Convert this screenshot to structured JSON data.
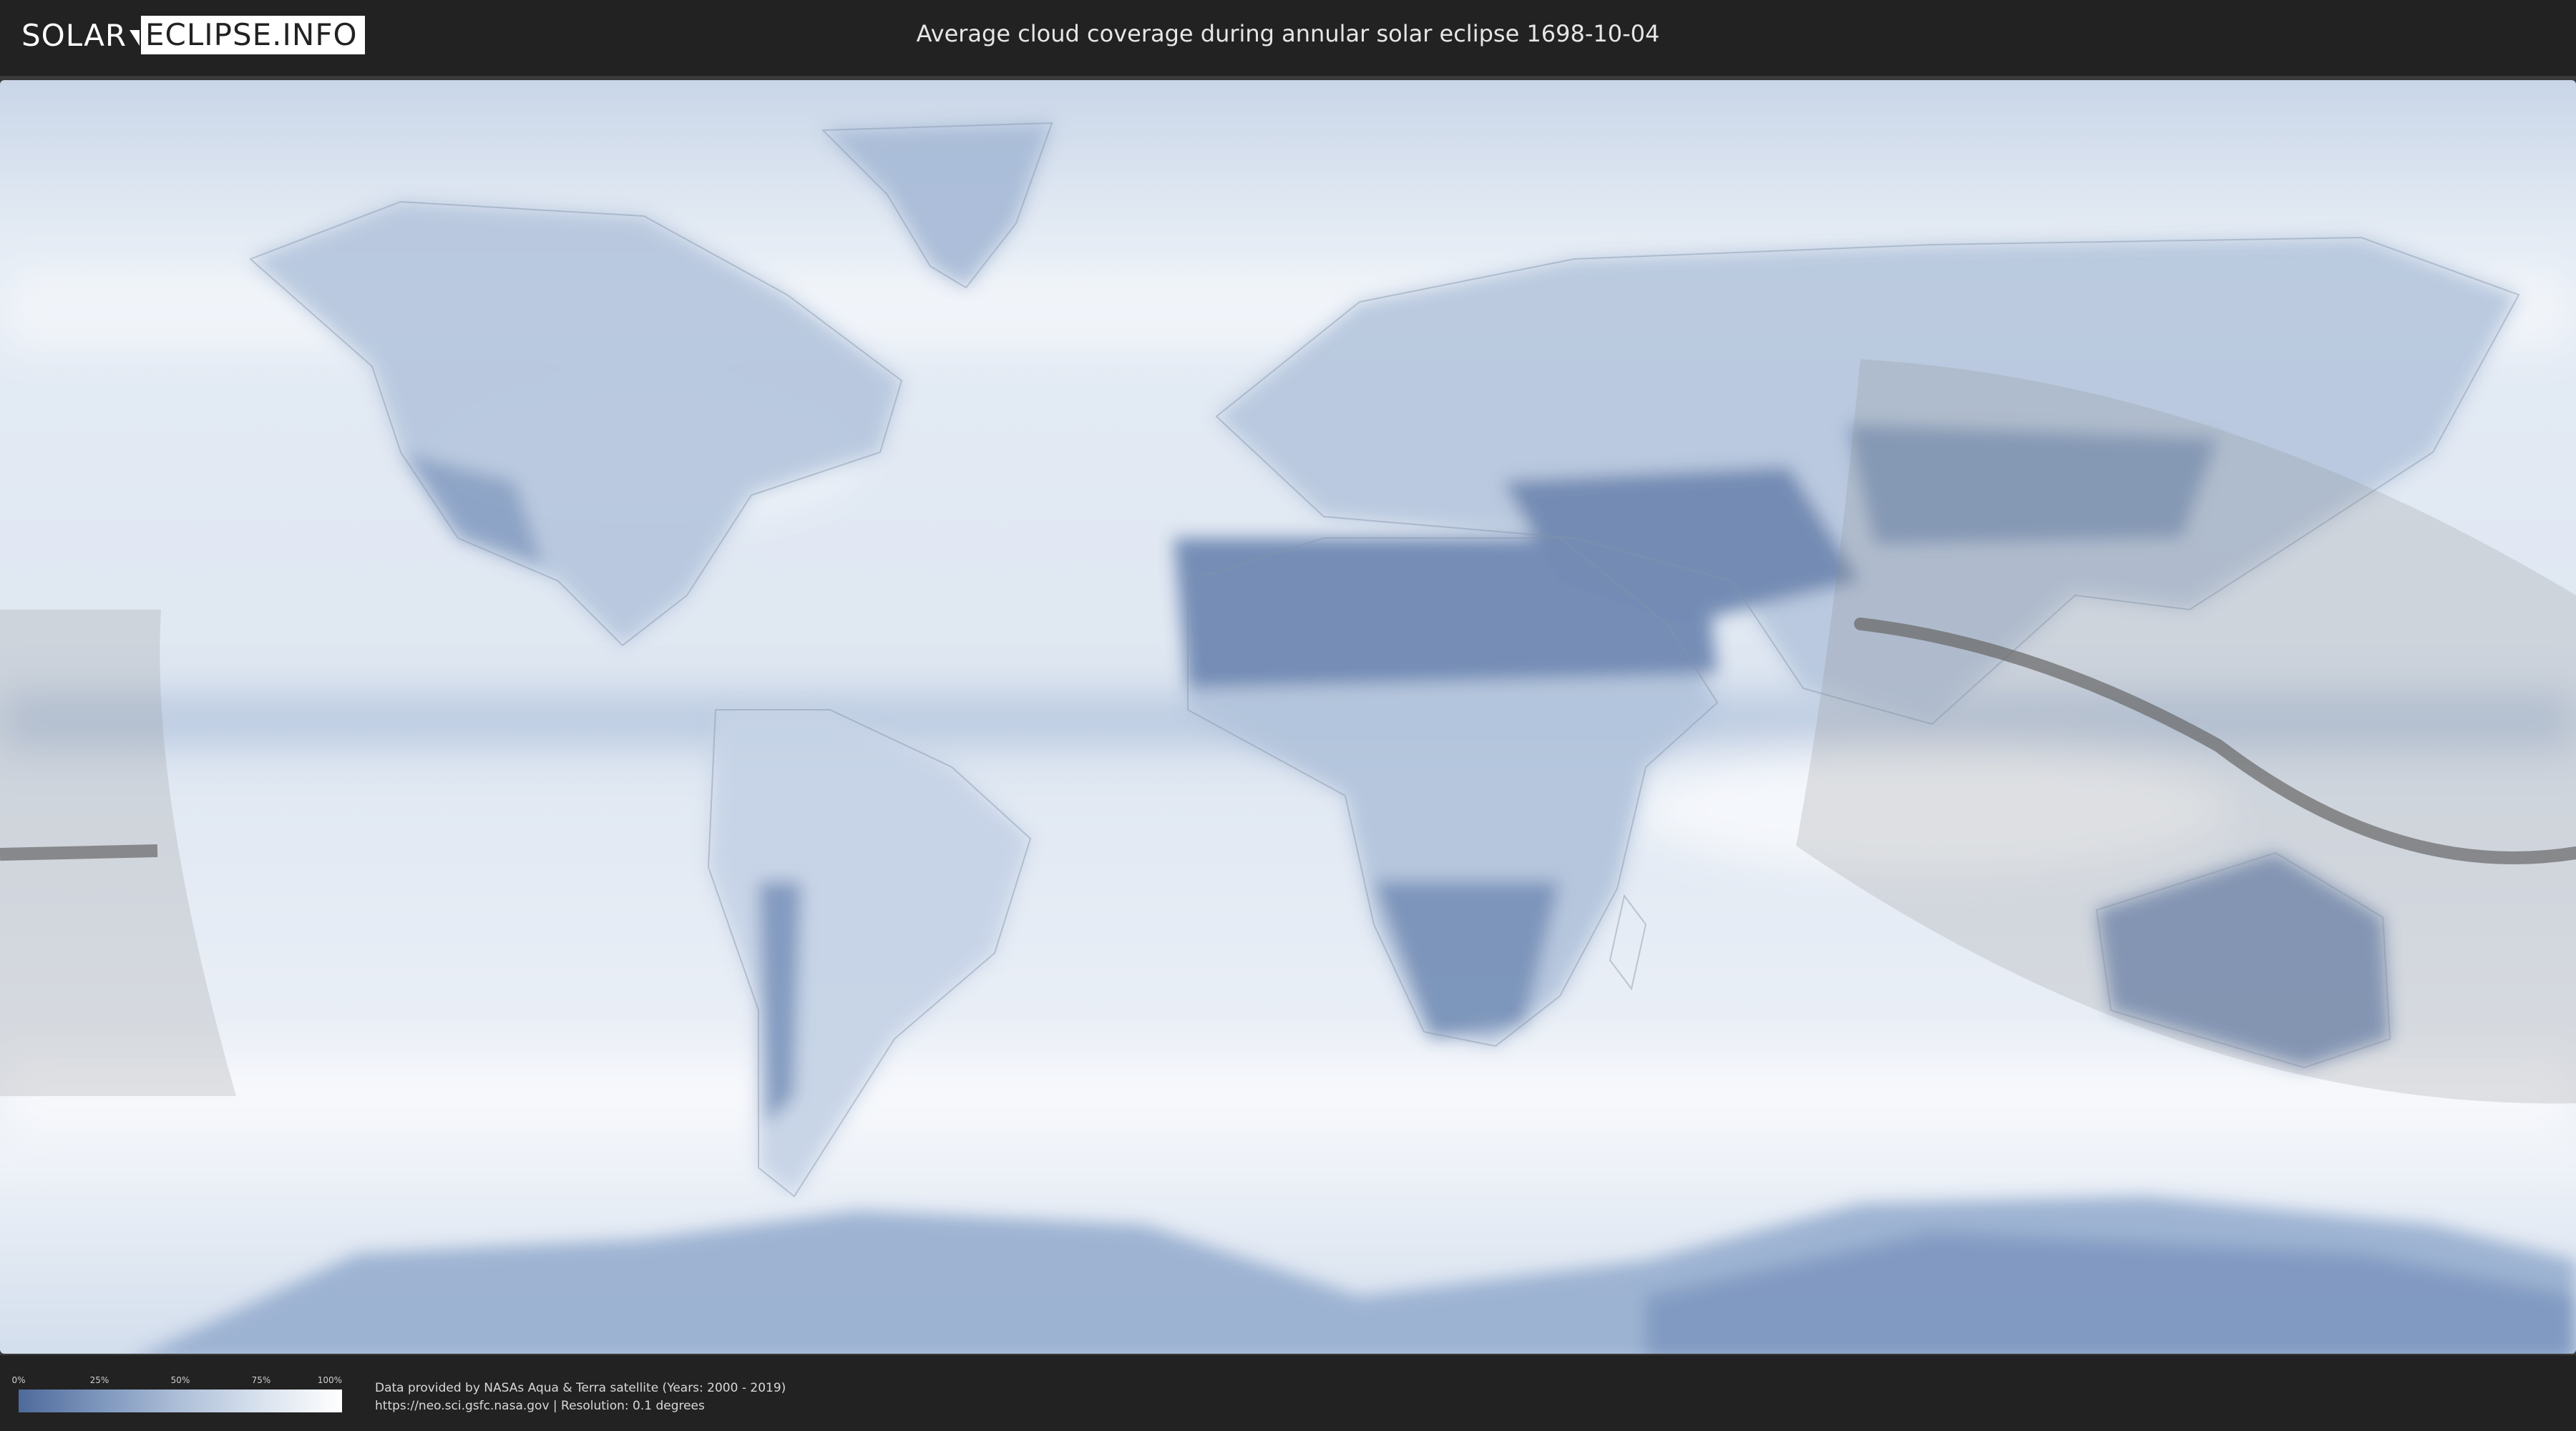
{
  "header": {
    "logo_solar": "SOLAR",
    "logo_eclipse": "ECLIPSE.INFO",
    "title": "Average cloud coverage during annular solar eclipse 1698-10-04"
  },
  "map": {
    "projection": "equirectangular",
    "layer": "average cloud coverage",
    "colors": {
      "clear": "#4e6a9a",
      "cloudy": "#ffffff",
      "eclipse_shade": "#9a9a9a",
      "central_line": "#666666"
    }
  },
  "legend": {
    "ticks": [
      "0%",
      "25%",
      "50%",
      "75%",
      "100%"
    ],
    "tick_fractions": [
      0,
      0.25,
      0.5,
      0.75,
      1
    ]
  },
  "credits": {
    "line1": "Data provided by NASAs Aqua & Terra satellite (Years: 2000 - 2019)",
    "line2": "https://neo.sci.gsfc.nasa.gov | Resolution: 0.1 degrees"
  }
}
